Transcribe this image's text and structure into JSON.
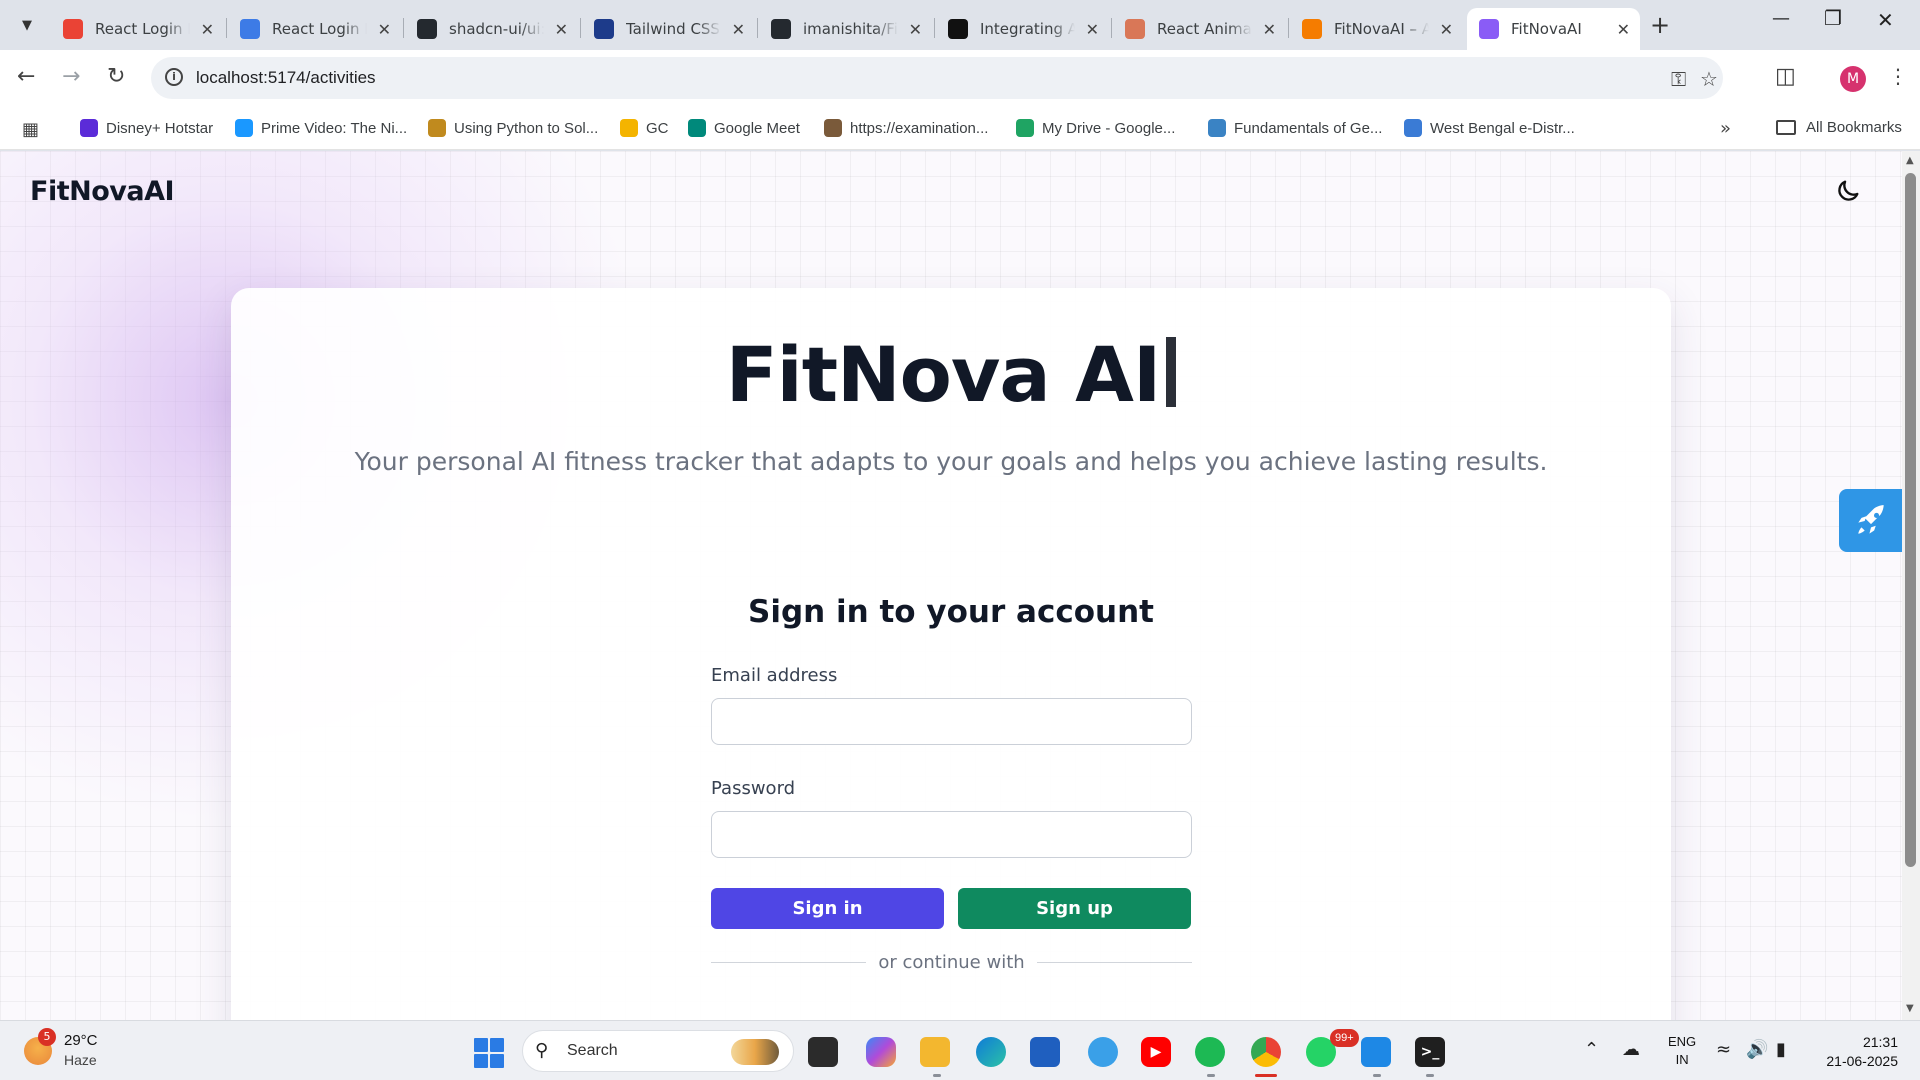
{
  "browser": {
    "tabs": [
      {
        "title": "React Login P",
        "icon": "gmail-icon",
        "color": "#ea4335"
      },
      {
        "title": "React Login P",
        "icon": "l-logo-icon",
        "color": "#3d7be6"
      },
      {
        "title": "shadcn-ui/ui:",
        "icon": "github-icon",
        "color": "#24292f"
      },
      {
        "title": "Tailwind CSS",
        "icon": "r-logo-icon",
        "color": "#1d3b8a"
      },
      {
        "title": "imanishita/Fi",
        "icon": "github-icon",
        "color": "#24292f"
      },
      {
        "title": "Integrating A",
        "icon": "openai-icon",
        "color": "#111111"
      },
      {
        "title": "React Animat",
        "icon": "claude-icon",
        "color": "#d97757"
      },
      {
        "title": "FitNovaAI – A",
        "icon": "firebase-icon",
        "color": "#f57c00"
      },
      {
        "title": "FitNovaAI",
        "icon": "vite-icon",
        "color": "#8a5cf6",
        "active": true
      }
    ],
    "url": "localhost:5174/activities",
    "bookmarks": [
      {
        "label": "Disney+ Hotstar",
        "color": "#5b2bd8"
      },
      {
        "label": "Prime Video: The Ni...",
        "color": "#1a98ff"
      },
      {
        "label": "Using Python to Sol...",
        "color": "#c08a1e"
      },
      {
        "label": "GC",
        "color": "#f4b400"
      },
      {
        "label": "Google Meet",
        "color": "#00897b"
      },
      {
        "label": "https://examination...",
        "color": "#7a5a3a"
      },
      {
        "label": "My Drive - Google...",
        "color": "#1fa463"
      },
      {
        "label": "Fundamentals of Ge...",
        "color": "#3a83c4"
      },
      {
        "label": "West Bengal e-Distr...",
        "color": "#3a7bd5"
      }
    ],
    "all_bookmarks": "All Bookmarks"
  },
  "page": {
    "brand": "FitNovaAI",
    "hero_title": "FitNova AI",
    "hero_subtitle": "Your personal AI fitness tracker that adapts to your goals and helps you achieve lasting results.",
    "form": {
      "title": "Sign in to your account",
      "email_label": "Email address",
      "email_value": "",
      "password_label": "Password",
      "password_value": "",
      "signin_label": "Sign in",
      "signup_label": "Sign up",
      "divider_text": "or continue with"
    },
    "colors": {
      "signin": "#4f46e5",
      "signup": "#0f8a5f",
      "accent_glow": "#d8b4fe"
    }
  },
  "taskbar": {
    "weather_temp": "29°C",
    "weather_desc": "Haze",
    "weather_badge": "5",
    "search_placeholder": "Search",
    "whatsapp_badge": "99+",
    "lang_line1": "ENG",
    "lang_line2": "IN",
    "time": "21:31",
    "date": "21-06-2025"
  }
}
